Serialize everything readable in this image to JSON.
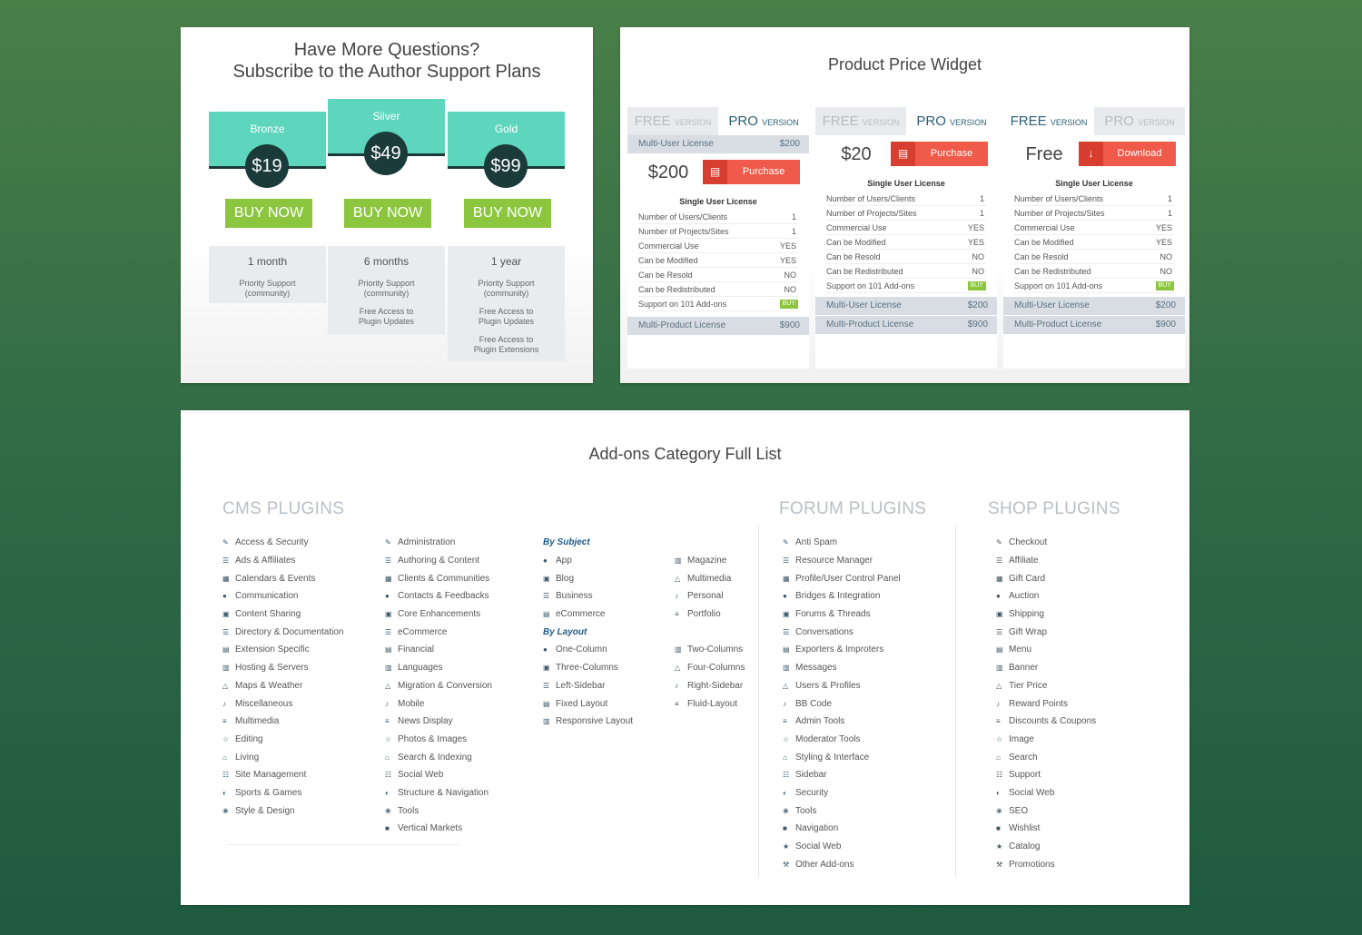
{
  "support": {
    "title_line1": "Have More Questions?",
    "title_line2": "Subscribe to the Author Support Plans",
    "plans": [
      {
        "name": "Bronze",
        "price": "$19",
        "buy": "BUY NOW",
        "duration": "1 month",
        "features": [
          "Priority Support (community)"
        ]
      },
      {
        "name": "Silver",
        "price": "$49",
        "buy": "BUY NOW",
        "duration": "6 months",
        "features": [
          "Priority Support (community)",
          "Free Access to Plugin Updates"
        ]
      },
      {
        "name": "Gold",
        "price": "$99",
        "buy": "BUY NOW",
        "duration": "1 year",
        "features": [
          "Priority Support (community)",
          "Free Access to Plugin Updates",
          "Free Access to Plugin Extensions"
        ]
      }
    ]
  },
  "price_widget": {
    "title": "Product Price Widget",
    "tab_free": "FREE",
    "tab_pro": "PRO",
    "tab_suffix": "VERSION",
    "single_user": "Single User License",
    "multi_user": {
      "label": "Multi-User License",
      "price": "$200"
    },
    "multi_product": {
      "label": "Multi-Product License",
      "price": "$900"
    },
    "widgets": [
      {
        "amount": "$200",
        "action": "Purchase",
        "action_icon": "cart-icon",
        "active_tab": "pro",
        "features": [
          {
            "label": "Number of Users/Clients",
            "value": "1"
          },
          {
            "label": "Number of Projects/Sites",
            "value": "1"
          },
          {
            "label": "Commercial Use",
            "value": "YES"
          },
          {
            "label": "Can be Modified",
            "value": "YES"
          },
          {
            "label": "Can be Resold",
            "value": "NO"
          },
          {
            "label": "Can be Redistributed",
            "value": "NO"
          },
          {
            "label": "Support on 101 Add-ons",
            "value": "BUY"
          }
        ]
      },
      {
        "amount": "$20",
        "action": "Purchase",
        "action_icon": "cart-icon",
        "active_tab": "pro",
        "features": [
          {
            "label": "Number of Users/Clients",
            "value": "1"
          },
          {
            "label": "Number of Projects/Sites",
            "value": "1"
          },
          {
            "label": "Commercial Use",
            "value": "YES"
          },
          {
            "label": "Can be Modified",
            "value": "YES"
          },
          {
            "label": "Can be Resold",
            "value": "NO"
          },
          {
            "label": "Can be Redistributed",
            "value": "NO"
          },
          {
            "label": "Support on 101 Add-ons",
            "value": "BUY"
          }
        ]
      },
      {
        "amount": "Free",
        "action": "Download",
        "action_icon": "download-icon",
        "active_tab": "free",
        "features": [
          {
            "label": "Number of Users/Clients",
            "value": "1"
          },
          {
            "label": "Number of Projects/Sites",
            "value": "1"
          },
          {
            "label": "Commercial Use",
            "value": "YES"
          },
          {
            "label": "Can be Modified",
            "value": "YES"
          },
          {
            "label": "Can be Resold",
            "value": "NO"
          },
          {
            "label": "Can be Redistributed",
            "value": "NO"
          },
          {
            "label": "Support on 101 Add-ons",
            "value": "BUY"
          }
        ]
      }
    ]
  },
  "addons": {
    "title": "Add-ons Category Full List",
    "cms_heading": "CMS PLUGINS",
    "forum_heading": "FORUM PLUGINS",
    "shop_heading": "SHOP PLUGINS",
    "cms_col1": [
      "Access & Security",
      "Ads & Affiliates",
      "Calendars & Events",
      "Communication",
      "Content Sharing",
      "Directory & Documentation",
      "Extension Specific",
      "Hosting & Servers",
      "Maps & Weather",
      "Miscellaneous",
      "Multimedia",
      "Editing",
      "Living",
      "Site Management",
      "Sports & Games",
      "Style & Design"
    ],
    "cms_col2": [
      "Administration",
      "Authoring & Content",
      "Clients & Communities",
      "Contacts & Feedbacks",
      "Core Enhancements",
      "eCommerce",
      "Financial",
      "Languages",
      "Migration & Conversion",
      "Mobile",
      "News Display",
      "Photos & Images",
      "Search & Indexing",
      "Social Web",
      "Structure & Navigation",
      "Tools",
      "Vertical Markets"
    ],
    "by_subject": "By Subject",
    "subject_col1": [
      "App",
      "Blog",
      "Business",
      "eCommerce"
    ],
    "subject_col2": [
      "Magazine",
      "Multimedia",
      "Personal",
      "Portfolio"
    ],
    "by_layout": "By Layout",
    "layout_col1": [
      "One-Column",
      "Three-Columns",
      "Left-Sidebar",
      "Fixed Layout",
      "Responsive Layout"
    ],
    "layout_col2": [
      "Two-Columns",
      "Four-Columns",
      "Right-Sidebar",
      "Fluid-Layout"
    ],
    "forum": [
      "Anti Spam",
      "Resource Manager",
      "Profile/User Control Panel",
      "Bridges & Integration",
      "Forums & Threads",
      "Conversations",
      "Exporters & Improters",
      "Messages",
      "Users & Profiles",
      "BB Code",
      "Admin Tools",
      "Moderator Tools",
      "Styling & Interface",
      "Sidebar",
      "Security",
      "Tools",
      "Navigation",
      "Social Web",
      "Other Add-ons"
    ],
    "shop": [
      "Checkout",
      "Affiliate",
      "Gift Card",
      "Auction",
      "Shipping",
      "Gift Wrap",
      "Menu",
      "Banner",
      "Tier Price",
      "Reward Points",
      "Discounts & Coupons",
      "Image",
      "Search",
      "Support",
      "Social Web",
      "SEO",
      "Wishlist",
      "Catalog",
      "Promotions"
    ]
  }
}
